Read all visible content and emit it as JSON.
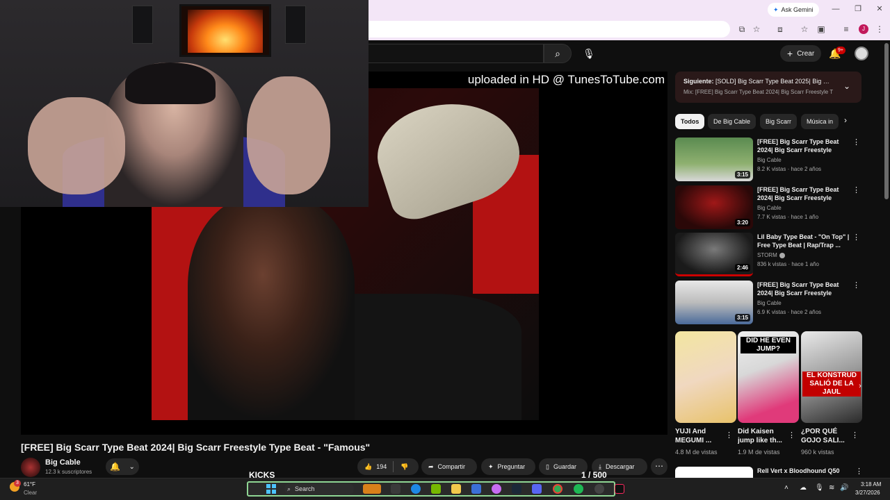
{
  "browser": {
    "ask_gemini": "Ask Gemini",
    "profile_initial": "J"
  },
  "masthead": {
    "create_label": "Crear",
    "notifications_badge": "9+"
  },
  "player": {
    "watermark": "uploaded in HD @ TunesToTube.com",
    "overlay_left_label": "KICKS",
    "overlay_page_count": "1 / 500"
  },
  "video": {
    "title": "[FREE] Big Scarr Type Beat 2024| Big Scarr Freestyle Type Beat - \"Famous\"",
    "channel_name": "Big Cable",
    "subscribers": "12.3 k suscriptores",
    "like_count": "194",
    "actions": {
      "share": "Compartir",
      "ask": "Preguntar",
      "save": "Guardar",
      "download": "Descargar"
    }
  },
  "up_next": {
    "label": "Siguiente:",
    "title": "[SOLD] Big Scarr Type Beat 2025| Big Sc...",
    "subtitle": "Mix: [FREE] Big Scarr Type Beat 2024| Big Scarr Freestyle Ty..."
  },
  "chips": [
    "Todos",
    "De Big Cable",
    "Big Scarr",
    "Música in"
  ],
  "recommendations": [
    {
      "title": "[FREE] Big Scarr Type Beat 2024| Big Scarr Freestyle Type...",
      "channel": "Big Cable",
      "meta": "8.2 K vistas · hace 2 años",
      "duration": "3:15",
      "verified": false
    },
    {
      "title": "[FREE] Big Scarr Type Beat 2024| Big Scarr Freestyle Type...",
      "channel": "Big Cable",
      "meta": "7.7 K vistas · hace 1 año",
      "duration": "3:20",
      "verified": false
    },
    {
      "title": "Lil Baby Type Beat - \"On Top\" | Free Type Beat | Rap/Trap ...",
      "channel": "STORM",
      "meta": "836 k vistas · hace 1 año",
      "duration": "2:46",
      "verified": true
    },
    {
      "title": "[FREE] Big Scarr Type Beat 2024| Big Scarr Freestyle Type...",
      "channel": "Big Cable",
      "meta": "6.9 K vistas · hace 2 años",
      "duration": "3:15",
      "verified": false
    }
  ],
  "shorts": [
    {
      "title": "YUJI And MEGUMI ...",
      "views": "4.8 M de vistas",
      "overlay": ""
    },
    {
      "title": "Did Kaisen jump like th...",
      "views": "1.9 M de vistas",
      "overlay": "DID HE EVEN JUMP?"
    },
    {
      "title": "¿POR QUÉ GOJO SALI...",
      "views": "960 k vistas",
      "overlay": "EL KONSTRUD SALIÓ DE LA JAUL"
    }
  ],
  "rec5": {
    "title": "Rell Vert x Bloodhound Q50"
  },
  "taskbar": {
    "weather_temp": "61°F",
    "weather_cond": "Clear",
    "weather_badge": "3",
    "search_label": "Search",
    "time": "3:18 AM",
    "date": "3/27/2026"
  },
  "colors": {
    "accent_red": "#cc0000",
    "background": "#0f0f0f",
    "chip_bg": "#272727"
  }
}
